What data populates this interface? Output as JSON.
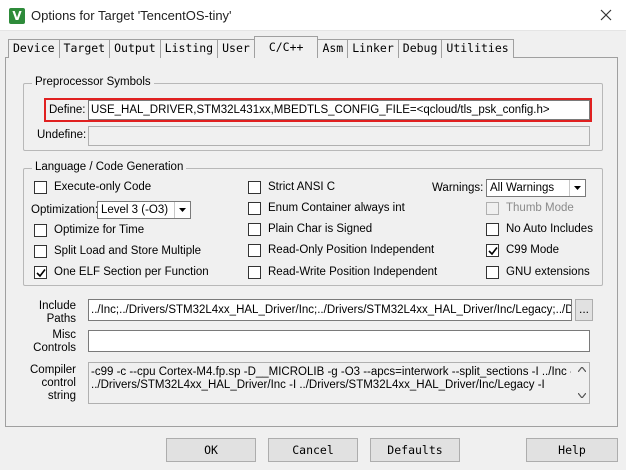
{
  "window": {
    "title": "Options for Target 'TencentOS-tiny'",
    "icon": "keil-uvision-icon"
  },
  "tabs": [
    {
      "label": "Device",
      "active": false
    },
    {
      "label": "Target",
      "active": false
    },
    {
      "label": "Output",
      "active": false
    },
    {
      "label": "Listing",
      "active": false
    },
    {
      "label": "User",
      "active": false
    },
    {
      "label": "C/C++",
      "active": true
    },
    {
      "label": "Asm",
      "active": false
    },
    {
      "label": "Linker",
      "active": false
    },
    {
      "label": "Debug",
      "active": false
    },
    {
      "label": "Utilities",
      "active": false
    }
  ],
  "preprocessor": {
    "group_title": "Preprocessor Symbols",
    "define_label": "Define:",
    "define_value": "USE_HAL_DRIVER,STM32L431xx,MBEDTLS_CONFIG_FILE=<qcloud/tls_psk_config.h>",
    "undefine_label": "Undefine:",
    "undefine_value": "",
    "highlight_color": "#e02020"
  },
  "language": {
    "group_title": "Language / Code Generation",
    "col1": {
      "execute_only": {
        "label": "Execute-only Code",
        "checked": false
      },
      "optimization_label": "Optimization:",
      "optimization_value": "Level 3 (-O3)",
      "optimize_time": {
        "label": "Optimize for Time",
        "checked": false
      },
      "split_load": {
        "label": "Split Load and Store Multiple",
        "checked": false
      },
      "one_elf": {
        "label": "One ELF Section per Function",
        "checked": true
      }
    },
    "col2": {
      "strict_ansi": {
        "label": "Strict ANSI C",
        "checked": false
      },
      "enum_container": {
        "label": "Enum Container always int",
        "checked": false
      },
      "plain_char": {
        "label": "Plain Char is Signed",
        "checked": false
      },
      "ro_pi": {
        "label": "Read-Only Position Independent",
        "checked": false
      },
      "rw_pi": {
        "label": "Read-Write Position Independent",
        "checked": false
      }
    },
    "col3": {
      "warnings_label": "Warnings:",
      "warnings_value": "All Warnings",
      "thumb_mode": {
        "label": "Thumb Mode",
        "checked": false,
        "disabled": true
      },
      "no_auto_includes": {
        "label": "No Auto Includes",
        "checked": false
      },
      "c99_mode": {
        "label": "C99 Mode",
        "checked": true
      },
      "gnu_extensions": {
        "label": "GNU extensions",
        "checked": false
      }
    }
  },
  "include_paths": {
    "label_line1": "Include",
    "label_line2": "Paths",
    "value": "../Inc;../Drivers/STM32L4xx_HAL_Driver/Inc;../Drivers/STM32L4xx_HAL_Driver/Inc/Legacy;../Drivers",
    "browse_label": "..."
  },
  "misc_controls": {
    "label_line1": "Misc",
    "label_line2": "Controls",
    "value": ""
  },
  "compiler_string": {
    "label_line1": "Compiler",
    "label_line2": "control",
    "label_line3": "string",
    "line1": "-c99 -c --cpu Cortex-M4.fp.sp -D__MICROLIB -g -O3 --apcs=interwork --split_sections -I ../Inc -I",
    "line2": "../Drivers/STM32L4xx_HAL_Driver/Inc -I ../Drivers/STM32L4xx_HAL_Driver/Inc/Legacy -I"
  },
  "buttons": {
    "ok": "OK",
    "cancel": "Cancel",
    "defaults": "Defaults",
    "help": "Help"
  }
}
